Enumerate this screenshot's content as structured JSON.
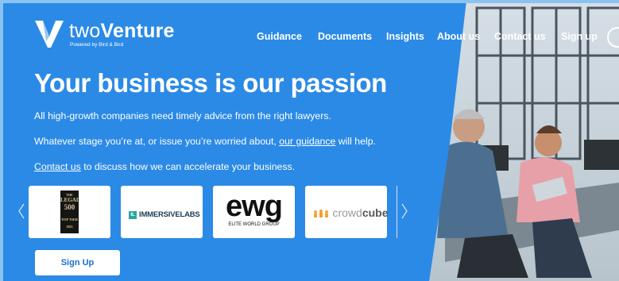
{
  "brand": {
    "name_light": "two",
    "name_bold": "Venture",
    "sub": "Powered by Bird & Bird"
  },
  "nav": {
    "items": [
      {
        "label": "Guidance"
      },
      {
        "label": "Documents"
      },
      {
        "label": "Insights"
      },
      {
        "label": "About us"
      },
      {
        "label": "Contact us"
      },
      {
        "label": "Sign up"
      }
    ]
  },
  "hero": {
    "title": "Your business is our passion",
    "line1": "All high-growth companies need timely advice from the right lawyers.",
    "line2_before": "Whatever stage you’re at, or issue you’re worried about, ",
    "line2_link": "our guidance",
    "line2_after": " will help.",
    "line3_link": "Contact us",
    "line3_after": " to discuss how we can accelerate your business."
  },
  "partners": [
    {
      "name": "legal-500",
      "text_top": "THE",
      "text_main": "LEGAL",
      "text_num": "500",
      "text_tier": "TOP TIER",
      "text_year": "2023"
    },
    {
      "name": "immersivelabs",
      "badge": "IL",
      "text": "IMMERSIVELABS"
    },
    {
      "name": "ewg",
      "text": "ewg",
      "sub": "ELITE WORLD GROUP"
    },
    {
      "name": "crowdcube",
      "text_light": "crowd",
      "text_bold": "cube"
    }
  ],
  "cta": {
    "signup_label": "Sign Up"
  },
  "colors": {
    "primary": "#2b8ae6",
    "link": "#1a6fd1",
    "white": "#ffffff"
  }
}
